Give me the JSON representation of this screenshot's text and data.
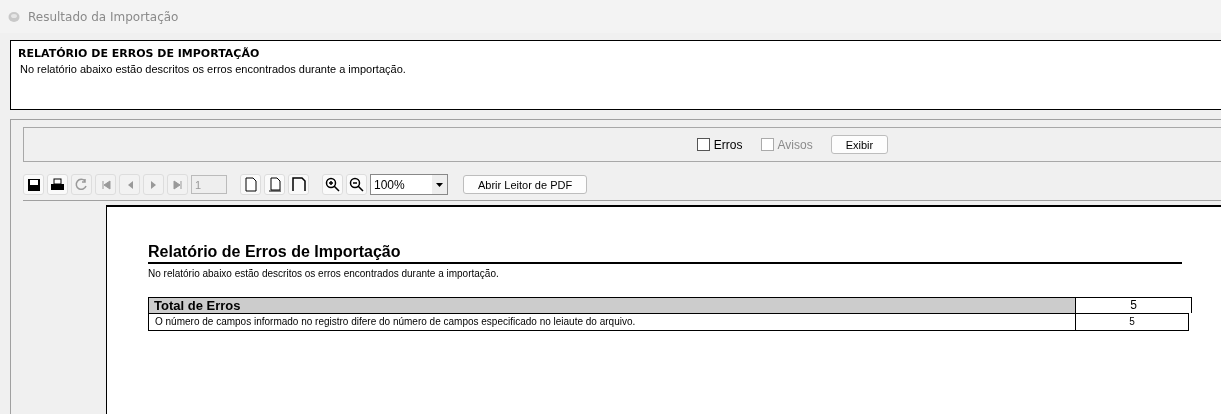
{
  "window": {
    "title": "Resultado da Importação"
  },
  "header": {
    "title": "RELATÓRIO DE ERROS DE IMPORTAÇÃO",
    "description": "No relatório abaixo estão descritos os erros encontrados durante a importação."
  },
  "filters": [
    {
      "label": "Erros",
      "checked": false,
      "disabled": false
    },
    {
      "label": "Avisos",
      "checked": false,
      "disabled": true
    }
  ],
  "show_button": "Exibir",
  "toolbar": {
    "tools": [
      {
        "kind": "save",
        "disabled": false
      },
      {
        "kind": "print",
        "disabled": false
      },
      {
        "kind": "refresh",
        "disabled": true
      },
      {
        "kind": "first",
        "disabled": true
      },
      {
        "kind": "prev",
        "disabled": true
      },
      {
        "kind": "next",
        "disabled": true
      },
      {
        "kind": "last",
        "disabled": true
      },
      {
        "kind": "page",
        "disabled": true
      },
      {
        "kind": "single",
        "disabled": false
      },
      {
        "kind": "width",
        "disabled": false
      },
      {
        "kind": "full",
        "disabled": false
      },
      {
        "kind": "zoomin",
        "disabled": false
      },
      {
        "kind": "zoomout",
        "disabled": false
      }
    ],
    "page": "1",
    "zoom": "100%",
    "pdf_button": "Abrir Leitor de PDF"
  },
  "report": {
    "title": "Relatório de Erros de Importação",
    "description": "No relatório abaixo estão descritos os erros encontrados durante a importação.",
    "total": {
      "label": "Total de Erros",
      "value": "5"
    },
    "rows": [
      {
        "description": "O número de campos informado no registro difere do número de campos especificado no leiaute do arquivo.",
        "count": "5"
      }
    ]
  }
}
